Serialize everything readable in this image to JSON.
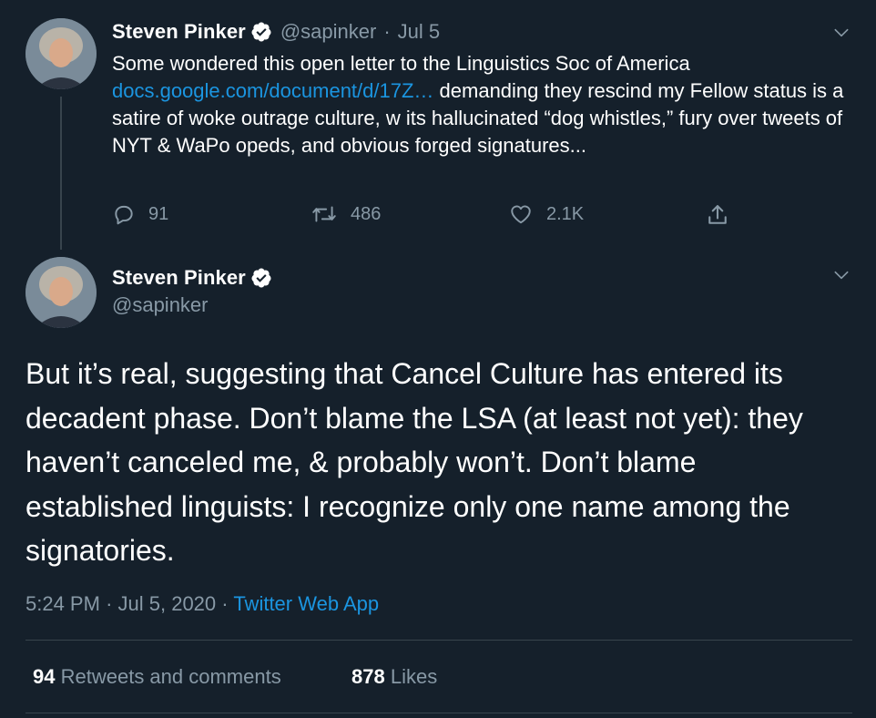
{
  "parent_tweet": {
    "author_name": "Steven Pinker",
    "handle": "@sapinker",
    "separator": "·",
    "date": "Jul 5",
    "text_before_link": "Some wondered this open letter to the Linguistics Soc of America ",
    "link_text": "docs.google.com/document/d/17Z…",
    "text_after_link": " demanding they rescind my Fellow status is a satire of woke outrage culture, w its hallucinated “dog whistles,” fury over tweets of NYT & WaPo opeds, and obvious forged signatures...",
    "replies": "91",
    "retweets": "486",
    "likes": "2.1K"
  },
  "main_tweet": {
    "author_name": "Steven Pinker",
    "handle": "@sapinker",
    "text": "But it’s real, suggesting that Cancel Culture has entered its decadent phase. Don’t blame the LSA (at least not yet): they haven’t canceled me, & probably won’t. Don’t blame established linguists: I recognize only one name among the signatories.",
    "time": "5:24 PM",
    "meta_sep": "·",
    "date": "Jul 5, 2020",
    "meta_sep2": "·",
    "source_app": "Twitter Web App",
    "retweet_count": "94",
    "retweet_label": "Retweets and comments",
    "like_count": "878",
    "like_label": "Likes"
  },
  "colors": {
    "background": "#15202b",
    "link": "#1b95e0",
    "muted": "#8899a6",
    "divider": "#38444d"
  },
  "icons": [
    "verified-badge-icon",
    "chevron-down-icon",
    "reply-icon",
    "retweet-icon",
    "like-icon",
    "share-icon"
  ]
}
